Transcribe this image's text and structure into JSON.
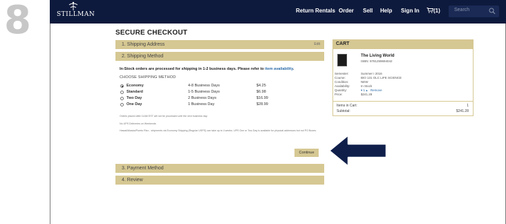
{
  "step_number": "8",
  "header": {
    "logo_text": "STILLMAN",
    "nav": [
      "Return Rentals",
      "Order",
      "Sell",
      "Help",
      "Sign In"
    ],
    "cart_label": "(1)",
    "search_placeholder": "Search"
  },
  "checkout": {
    "title": "SECURE CHECKOUT",
    "steps": {
      "shipping_address": "1. Shipping Address",
      "edit": "Edit",
      "shipping_method": "2. Shipping Method",
      "payment_method": "3. Payment Method",
      "review": "4. Review"
    },
    "instock_text": "In-Stock orders are processed for shipping in 1-2 business days. Please refer to",
    "instock_link": "item availability",
    "instock_end": ".",
    "choose_label": "CHOOSE SHIPPING METHOD",
    "options": [
      {
        "name": "Economy",
        "days": "4-8 Business Days",
        "price": "$4.25",
        "selected": true
      },
      {
        "name": "Standard",
        "days": "1-5 Business Days",
        "price": "$6.98",
        "selected": false
      },
      {
        "name": "Two Day",
        "days": "2 Business Days",
        "price": "$16.99",
        "selected": false
      },
      {
        "name": "One Day",
        "days": "1 Business Day",
        "price": "$28.99",
        "selected": false
      }
    ],
    "note1": "Orders placed after 11AM EST will not be processed until the next business day.",
    "note2": "No UPS Deliveries on Weekends",
    "note3": "Hawaii/Alaska/Puerto Rico - shipments via Economy Shipping (Regular USPS) can take up to 4 weeks. UPS One or Two Day is available for physical addresses but not PO Boxes.",
    "continue_label": "Continue"
  },
  "cart": {
    "title": "CART",
    "book_title": "The Living World",
    "isbn": "ISBN: 9781259694042",
    "fields": [
      {
        "label": "Semester:",
        "value": "Summer I 2016"
      },
      {
        "label": "Course:",
        "value": "BIO 131 OLC LIFE SCIENCE"
      },
      {
        "label": "Condition:",
        "value": "NEW"
      },
      {
        "label": "Availability:",
        "value": "In Stock"
      },
      {
        "label": "Quantity:",
        "value": "1"
      },
      {
        "label": "Price:",
        "value": "$241.28"
      }
    ],
    "remove_label": "Remove",
    "items_label": "Items in Cart:",
    "items_value": "1",
    "subtotal_label": "Subtotal:",
    "subtotal_value": "$241.28"
  },
  "colors": {
    "navy": "#0e1a3d",
    "tan": "#d6c893",
    "link": "#2a6aa8",
    "arrow": "#0f1f4a"
  }
}
